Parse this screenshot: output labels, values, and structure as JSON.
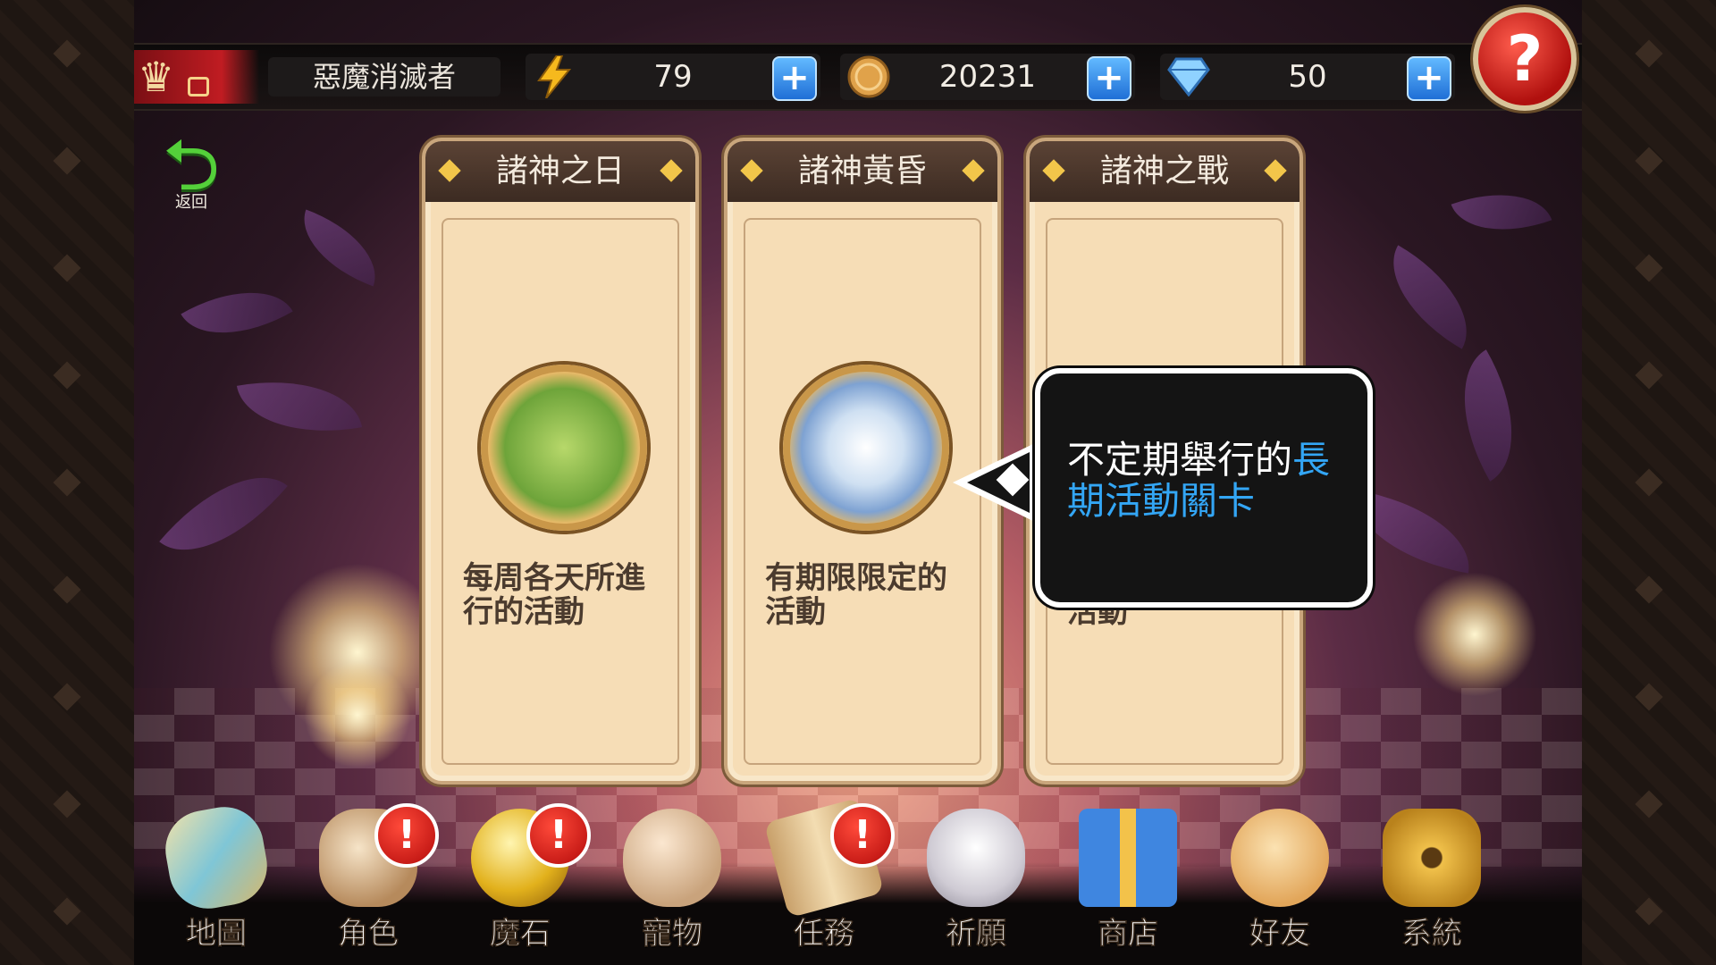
{
  "player": {
    "title": "惡魔消滅者"
  },
  "resources": {
    "stamina": {
      "icon": "lightning-icon",
      "value": "79"
    },
    "coins": {
      "icon": "coin-icon",
      "value": "20231"
    },
    "gems": {
      "icon": "diamond-icon",
      "value": "50"
    }
  },
  "plus_label": "+",
  "help_label": "?",
  "back_label": "返回",
  "cards": [
    {
      "title": "諸神之日",
      "desc": "每周各天所進行的活動"
    },
    {
      "title": "諸神黃昏",
      "desc": "有期限限定的活動"
    },
    {
      "title": "諸神之戰",
      "desc": "活動"
    }
  ],
  "tooltip": {
    "text_plain": "不定期舉行的",
    "text_highlight": "長期活動關卡",
    "highlight_color": "#33a6f5"
  },
  "nav": [
    {
      "label": "地圖",
      "icon": "map-icon",
      "alert": false
    },
    {
      "label": "角色",
      "icon": "character-icon",
      "alert": true
    },
    {
      "label": "魔石",
      "icon": "magic-stone-icon",
      "alert": true
    },
    {
      "label": "寵物",
      "icon": "pet-egg-icon",
      "alert": false
    },
    {
      "label": "任務",
      "icon": "scroll-icon",
      "alert": true
    },
    {
      "label": "祈願",
      "icon": "prayer-icon",
      "alert": false
    },
    {
      "label": "商店",
      "icon": "gift-box-icon",
      "alert": false
    },
    {
      "label": "好友",
      "icon": "friends-icon",
      "alert": false
    },
    {
      "label": "系統",
      "icon": "gear-icon",
      "alert": false
    }
  ],
  "alert_label": "!"
}
